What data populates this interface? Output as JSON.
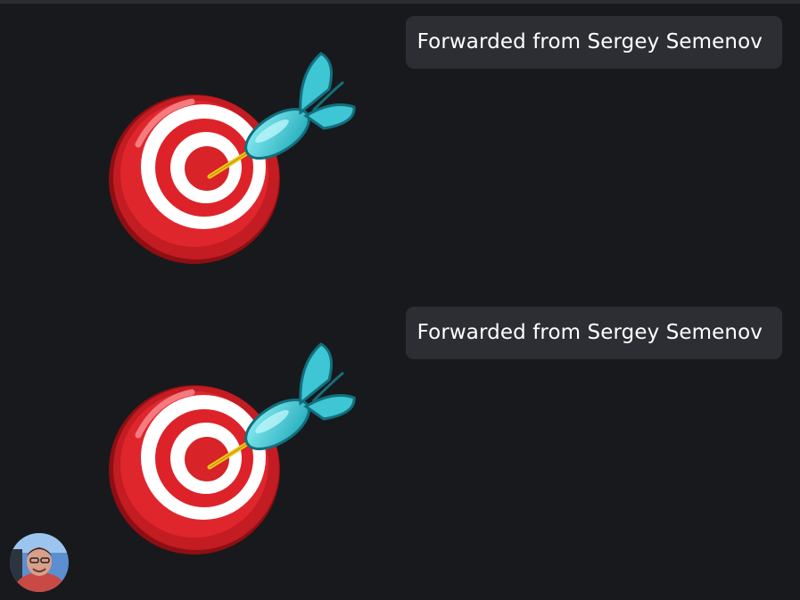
{
  "messages": [
    {
      "forwarded_label": "Forwarded from Sergey Semenov",
      "sticker": "dart-target-icon"
    },
    {
      "forwarded_label": "Forwarded from Sergey Semenov",
      "sticker": "dart-target-icon"
    }
  ],
  "avatar": {
    "icon": "user-avatar"
  },
  "colors": {
    "background": "#18191c",
    "badge": "#2c2e33",
    "target_red": "#d8262b",
    "dart_cyan": "#3ec6d4"
  }
}
